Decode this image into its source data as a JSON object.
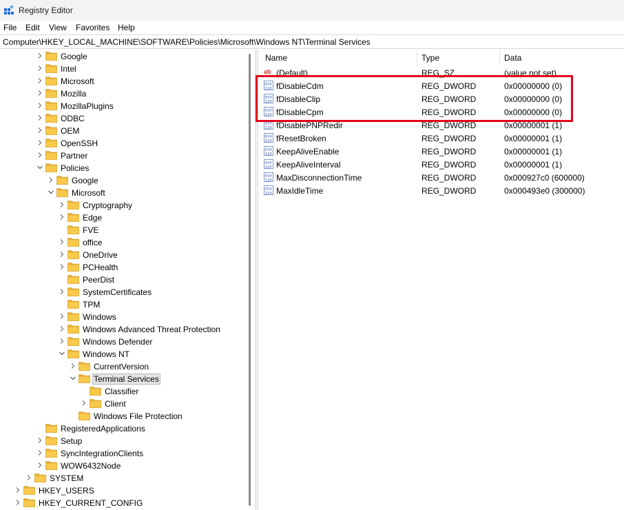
{
  "window": {
    "title": "Registry Editor",
    "icon": "registry-editor-icon"
  },
  "menu": [
    "File",
    "Edit",
    "View",
    "Favorites",
    "Help"
  ],
  "address": "Computer\\HKEY_LOCAL_MACHINE\\SOFTWARE\\Policies\\Microsoft\\Windows NT\\Terminal Services",
  "tree": [
    {
      "label": "Google",
      "expanded": false,
      "level": 3
    },
    {
      "label": "Intel",
      "expanded": false,
      "level": 3
    },
    {
      "label": "Microsoft",
      "expanded": false,
      "level": 3
    },
    {
      "label": "Mozilla",
      "expanded": false,
      "level": 3
    },
    {
      "label": "MozillaPlugins",
      "expanded": false,
      "level": 3
    },
    {
      "label": "ODBC",
      "expanded": false,
      "level": 3
    },
    {
      "label": "OEM",
      "expanded": false,
      "level": 3
    },
    {
      "label": "OpenSSH",
      "expanded": false,
      "level": 3
    },
    {
      "label": "Partner",
      "expanded": false,
      "level": 3
    },
    {
      "label": "Policies",
      "expanded": true,
      "level": 3
    },
    {
      "label": "Google",
      "expanded": false,
      "level": 4
    },
    {
      "label": "Microsoft",
      "expanded": true,
      "level": 4
    },
    {
      "label": "Cryptography",
      "expanded": false,
      "level": 5
    },
    {
      "label": "Edge",
      "expanded": false,
      "level": 5
    },
    {
      "label": "FVE",
      "expanded": null,
      "level": 5
    },
    {
      "label": "office",
      "expanded": false,
      "level": 5
    },
    {
      "label": "OneDrive",
      "expanded": false,
      "level": 5
    },
    {
      "label": "PCHealth",
      "expanded": false,
      "level": 5
    },
    {
      "label": "PeerDist",
      "expanded": null,
      "level": 5
    },
    {
      "label": "SystemCertificates",
      "expanded": false,
      "level": 5
    },
    {
      "label": "TPM",
      "expanded": null,
      "level": 5
    },
    {
      "label": "Windows",
      "expanded": false,
      "level": 5
    },
    {
      "label": "Windows Advanced Threat Protection",
      "expanded": false,
      "level": 5
    },
    {
      "label": "Windows Defender",
      "expanded": false,
      "level": 5
    },
    {
      "label": "Windows NT",
      "expanded": true,
      "level": 5
    },
    {
      "label": "CurrentVersion",
      "expanded": false,
      "level": 6
    },
    {
      "label": "Terminal Services",
      "expanded": true,
      "level": 6,
      "selected": true
    },
    {
      "label": "Classifier",
      "expanded": null,
      "level": 7
    },
    {
      "label": "Client",
      "expanded": false,
      "level": 7
    },
    {
      "label": "Windows File Protection",
      "expanded": null,
      "level": 6
    },
    {
      "label": "RegisteredApplications",
      "expanded": null,
      "level": 3
    },
    {
      "label": "Setup",
      "expanded": false,
      "level": 3
    },
    {
      "label": "SyncIntegrationClients",
      "expanded": false,
      "level": 3
    },
    {
      "label": "WOW6432Node",
      "expanded": false,
      "level": 3
    },
    {
      "label": "SYSTEM",
      "expanded": false,
      "level": 2
    },
    {
      "label": "HKEY_USERS",
      "expanded": false,
      "level": 1
    },
    {
      "label": "HKEY_CURRENT_CONFIG",
      "expanded": false,
      "level": 1
    }
  ],
  "columns": {
    "name": "Name",
    "type": "Type",
    "data": "Data"
  },
  "values": [
    {
      "name": "(Default)",
      "type": "REG_SZ",
      "data": "(value not set)",
      "icon": "string-value-icon"
    },
    {
      "name": "fDisableCdm",
      "type": "REG_DWORD",
      "data": "0x00000000 (0)",
      "icon": "binary-value-icon"
    },
    {
      "name": "fDisableClip",
      "type": "REG_DWORD",
      "data": "0x00000000 (0)",
      "icon": "binary-value-icon"
    },
    {
      "name": "fDisableCpm",
      "type": "REG_DWORD",
      "data": "0x00000000 (0)",
      "icon": "binary-value-icon"
    },
    {
      "name": "fDisablePNPRedir",
      "type": "REG_DWORD",
      "data": "0x00000001 (1)",
      "icon": "binary-value-icon"
    },
    {
      "name": "fResetBroken",
      "type": "REG_DWORD",
      "data": "0x00000001 (1)",
      "icon": "binary-value-icon"
    },
    {
      "name": "KeepAliveEnable",
      "type": "REG_DWORD",
      "data": "0x00000001 (1)",
      "icon": "binary-value-icon"
    },
    {
      "name": "KeepAliveInterval",
      "type": "REG_DWORD",
      "data": "0x00000001 (1)",
      "icon": "binary-value-icon"
    },
    {
      "name": "MaxDisconnectionTime",
      "type": "REG_DWORD",
      "data": "0x000927c0 (600000)",
      "icon": "binary-value-icon"
    },
    {
      "name": "MaxIdleTime",
      "type": "REG_DWORD",
      "data": "0x000493e0 (300000)",
      "icon": "binary-value-icon"
    }
  ],
  "highlight_color": "#e3001b",
  "folder_color": "#f8c94b"
}
